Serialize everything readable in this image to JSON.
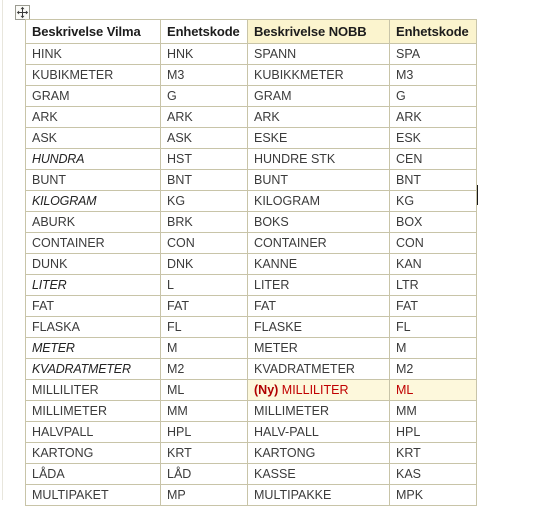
{
  "document": {
    "move_handle_icon": "move-four-arrows-icon"
  },
  "table": {
    "headers": [
      {
        "label": "Beskrivelse Vilma",
        "tinted": false
      },
      {
        "label": "Enhetskode",
        "tinted": false
      },
      {
        "label": "Beskrivelse NOBB",
        "tinted": true
      },
      {
        "label": "Enhetskode",
        "tinted": true
      }
    ],
    "rows": [
      {
        "vilma_desc": "HINK",
        "vilma_code": "HNK",
        "nobb_desc": "SPANN",
        "nobb_code": "SPA",
        "emph": false,
        "flag": false,
        "tag": ""
      },
      {
        "vilma_desc": "KUBIKMETER",
        "vilma_code": "M3",
        "nobb_desc": "KUBIKKMETER",
        "nobb_code": "M3",
        "emph": false,
        "flag": false,
        "tag": ""
      },
      {
        "vilma_desc": "GRAM",
        "vilma_code": "G",
        "nobb_desc": "GRAM",
        "nobb_code": "G",
        "emph": false,
        "flag": false,
        "tag": ""
      },
      {
        "vilma_desc": "ARK",
        "vilma_code": "ARK",
        "nobb_desc": "ARK",
        "nobb_code": "ARK",
        "emph": false,
        "flag": false,
        "tag": ""
      },
      {
        "vilma_desc": "ASK",
        "vilma_code": "ASK",
        "nobb_desc": "ESKE",
        "nobb_code": "ESK",
        "emph": false,
        "flag": false,
        "tag": ""
      },
      {
        "vilma_desc": "HUNDRA",
        "vilma_code": "HST",
        "nobb_desc": "HUNDRE STK",
        "nobb_code": "CEN",
        "emph": true,
        "flag": false,
        "tag": ""
      },
      {
        "vilma_desc": "BUNT",
        "vilma_code": "BNT",
        "nobb_desc": "BUNT",
        "nobb_code": "BNT",
        "emph": false,
        "flag": false,
        "tag": ""
      },
      {
        "vilma_desc": "KILOGRAM",
        "vilma_code": "KG",
        "nobb_desc": "KILOGRAM",
        "nobb_code": "KG",
        "emph": true,
        "flag": false,
        "tag": ""
      },
      {
        "vilma_desc": "ABURK",
        "vilma_code": "BRK",
        "nobb_desc": "BOKS",
        "nobb_code": "BOX",
        "emph": false,
        "flag": false,
        "tag": ""
      },
      {
        "vilma_desc": "CONTAINER",
        "vilma_code": "CON",
        "nobb_desc": "CONTAINER",
        "nobb_code": "CON",
        "emph": false,
        "flag": false,
        "tag": ""
      },
      {
        "vilma_desc": "DUNK",
        "vilma_code": "DNK",
        "nobb_desc": "KANNE",
        "nobb_code": "KAN",
        "emph": false,
        "flag": false,
        "tag": ""
      },
      {
        "vilma_desc": "LITER",
        "vilma_code": "L",
        "nobb_desc": "LITER",
        "nobb_code": "LTR",
        "emph": true,
        "flag": false,
        "tag": ""
      },
      {
        "vilma_desc": "FAT",
        "vilma_code": "FAT",
        "nobb_desc": "FAT",
        "nobb_code": "FAT",
        "emph": false,
        "flag": false,
        "tag": ""
      },
      {
        "vilma_desc": "FLASKA",
        "vilma_code": "FL",
        "nobb_desc": "FLASKE",
        "nobb_code": "FL",
        "emph": false,
        "flag": false,
        "tag": ""
      },
      {
        "vilma_desc": "METER",
        "vilma_code": "M",
        "nobb_desc": "METER",
        "nobb_code": "M",
        "emph": true,
        "flag": false,
        "tag": ""
      },
      {
        "vilma_desc": "KVADRATMETER",
        "vilma_code": "M2",
        "nobb_desc": "KVADRATMETER",
        "nobb_code": "M2",
        "emph": true,
        "flag": false,
        "tag": ""
      },
      {
        "vilma_desc": "MILLILITER",
        "vilma_code": "ML",
        "nobb_desc": "MILLILITER",
        "nobb_code": "ML",
        "emph": false,
        "flag": true,
        "tag": "(Ny)"
      },
      {
        "vilma_desc": "MILLIMETER",
        "vilma_code": "MM",
        "nobb_desc": "MILLIMETER",
        "nobb_code": "MM",
        "emph": false,
        "flag": false,
        "tag": ""
      },
      {
        "vilma_desc": "HALVPALL",
        "vilma_code": "HPL",
        "nobb_desc": "HALV-PALL",
        "nobb_code": "HPL",
        "emph": false,
        "flag": false,
        "tag": ""
      },
      {
        "vilma_desc": "KARTONG",
        "vilma_code": "KRT",
        "nobb_desc": "KARTONG",
        "nobb_code": "KRT",
        "emph": false,
        "flag": false,
        "tag": ""
      },
      {
        "vilma_desc": "LÅDA",
        "vilma_code": "LÅD",
        "nobb_desc": "KASSE",
        "nobb_code": "KAS",
        "emph": false,
        "flag": false,
        "tag": ""
      },
      {
        "vilma_desc": "MULTIPAKET",
        "vilma_code": "MP",
        "nobb_desc": "MULTIPAKKE",
        "nobb_code": "MPK",
        "emph": false,
        "flag": false,
        "tag": ""
      }
    ]
  },
  "colors": {
    "header_tint": "#fbf4ce",
    "row_flag_background": "#fdf8dc",
    "flag_text": "#c00000",
    "border": "#c8c4a8"
  }
}
